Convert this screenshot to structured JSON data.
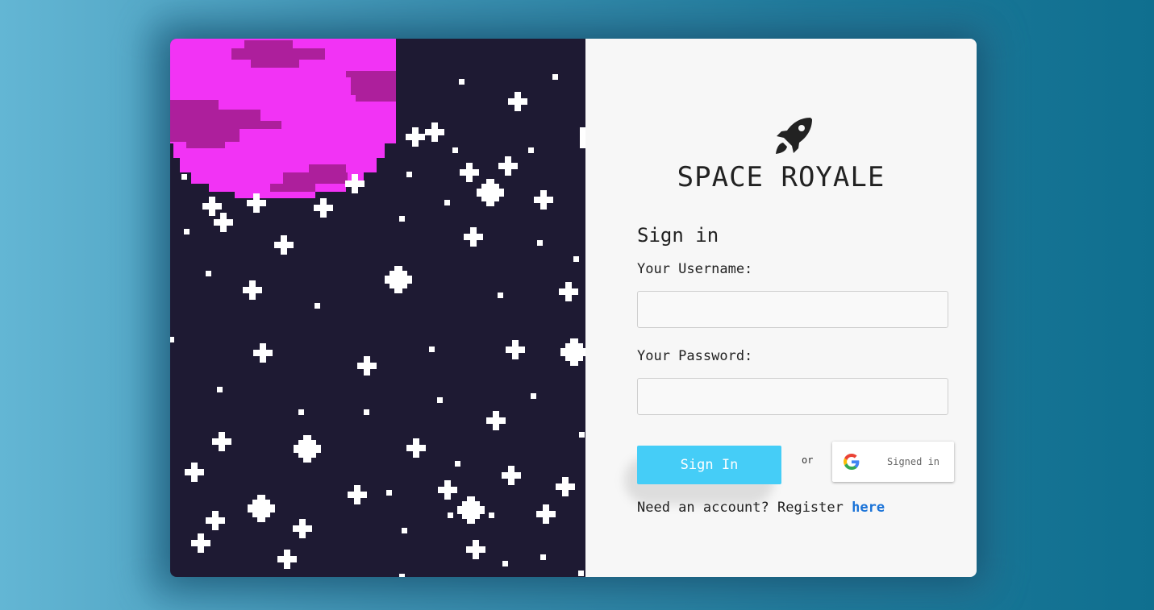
{
  "app": {
    "title": "SPACE ROYALE",
    "logo_icon": "rocket-icon"
  },
  "form": {
    "heading": "Sign in",
    "username_label": "Your Username:",
    "username_value": "",
    "password_label": "Your Password:",
    "password_value": "",
    "signin_button_label": "Sign In",
    "or_label": "or",
    "google_button_label": "Signed in",
    "google_icon": "google-icon",
    "register_text": "Need an account? Register",
    "register_link_text": "here"
  },
  "colors": {
    "accent": "#45cdf7",
    "link": "#1a73d8",
    "space_background": "#1e1a33",
    "planet": "#f233f5",
    "planet_band": "#ad1f9c"
  }
}
